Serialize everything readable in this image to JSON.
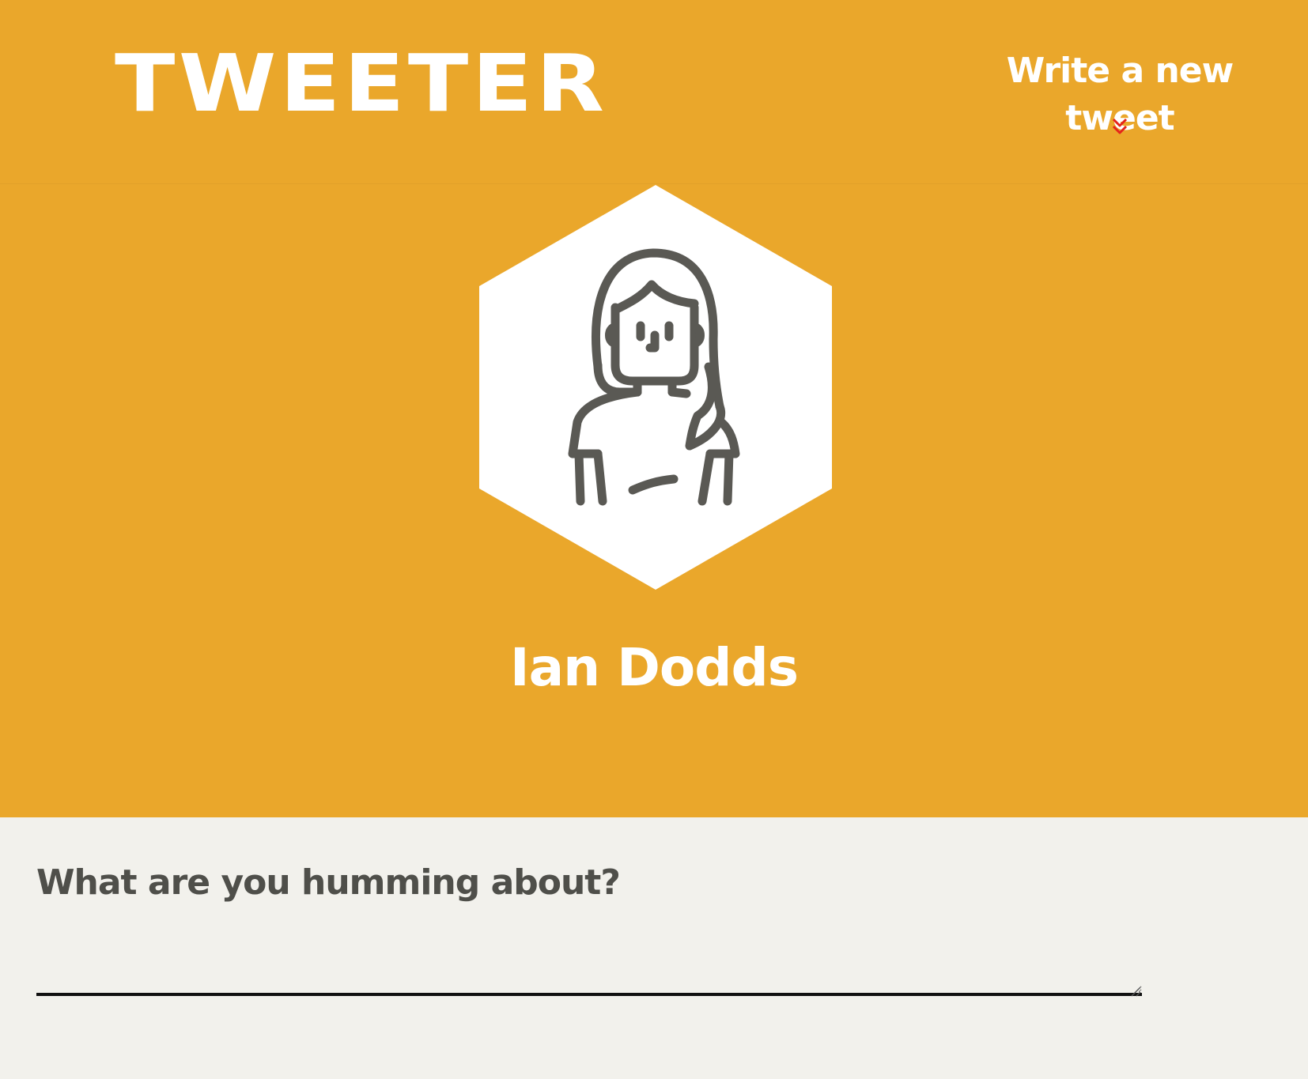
{
  "header": {
    "logo": "TWEETER",
    "compose_link": "Write a new tweet",
    "compose_icon": "double-chevron-down-icon",
    "accent_color": "#eaa72b",
    "icon_color": "#e5231b"
  },
  "profile": {
    "avatar_icon": "woman-avatar-icon",
    "name": "Ian Dodds"
  },
  "composer": {
    "label": "What are you humming about?",
    "value": ""
  }
}
